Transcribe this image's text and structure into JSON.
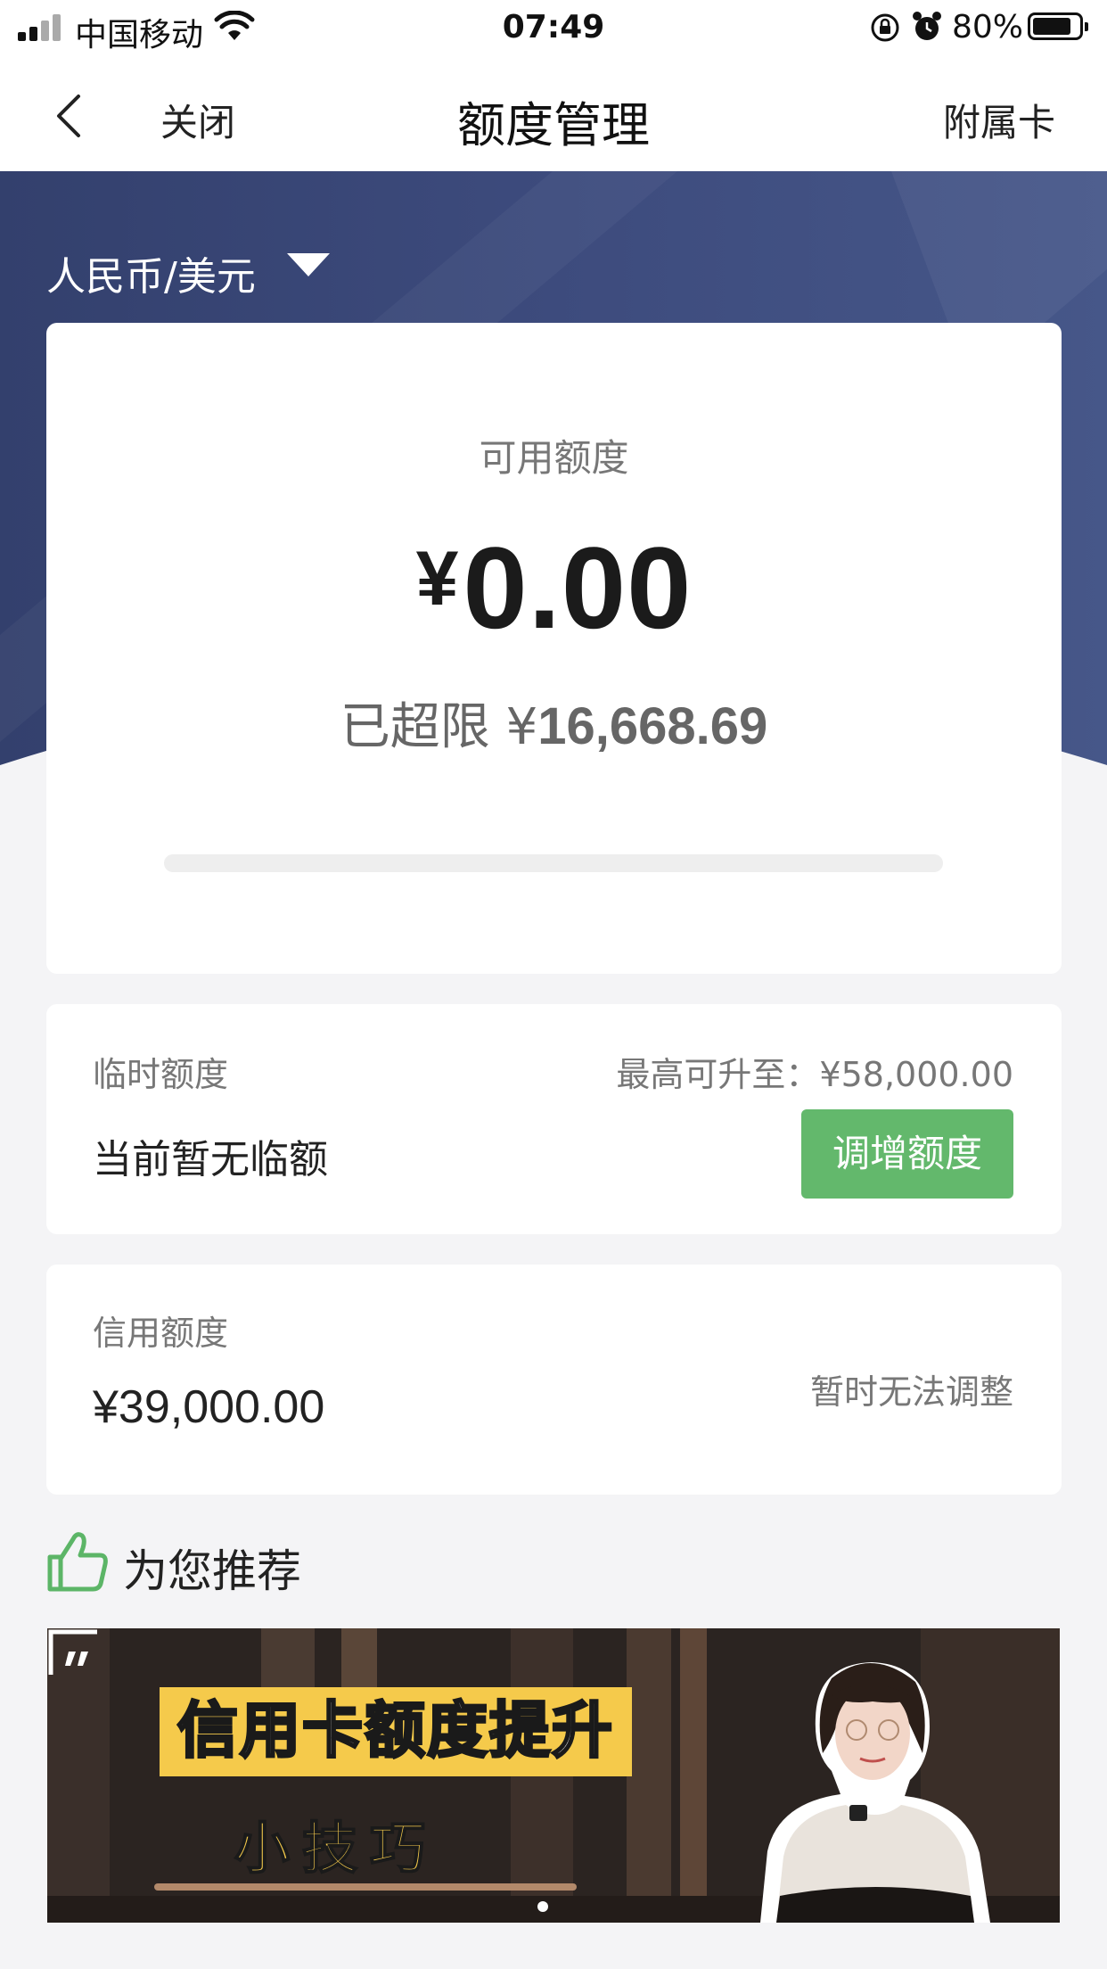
{
  "status_bar": {
    "carrier": "中国移动",
    "time": "07:49",
    "battery_percent": "80%",
    "battery_level": 0.8,
    "icons": [
      "signal-icon",
      "wifi-icon",
      "orientation-lock-icon",
      "alarm-icon",
      "battery-icon"
    ]
  },
  "nav": {
    "back_icon": "chevron-left-icon",
    "close_label": "关闭",
    "title": "额度管理",
    "supplementary_card_label": "附属卡"
  },
  "currency": {
    "selected": "人民币/美元",
    "dropdown_icon": "triangle-down-icon"
  },
  "available": {
    "label": "可用额度",
    "currency_symbol": "¥",
    "amount": "0.00",
    "over_limit_label": "已超限",
    "over_limit_symbol": "¥",
    "over_limit_amount": "16,668.69",
    "usage_fraction": 0
  },
  "temporary": {
    "label": "临时额度",
    "max_label": "最高可升至：¥58,000.00",
    "status": "当前暂无临额",
    "button_label": "调增额度"
  },
  "credit": {
    "label": "信用额度",
    "amount": "¥39,000.00",
    "note": "暂时无法调整"
  },
  "recommend": {
    "icon": "thumbs-up-icon",
    "title": "为您推荐"
  },
  "banner": {
    "title": "信用卡额度提升",
    "subtitle": "小技巧",
    "quote_icon": "quote-icon"
  },
  "colors": {
    "hero_bg": "#3c4b7c",
    "accent_green": "#63b86c",
    "banner_yellow": "#f5ca4b",
    "page_bg": "#f4f4f6"
  }
}
